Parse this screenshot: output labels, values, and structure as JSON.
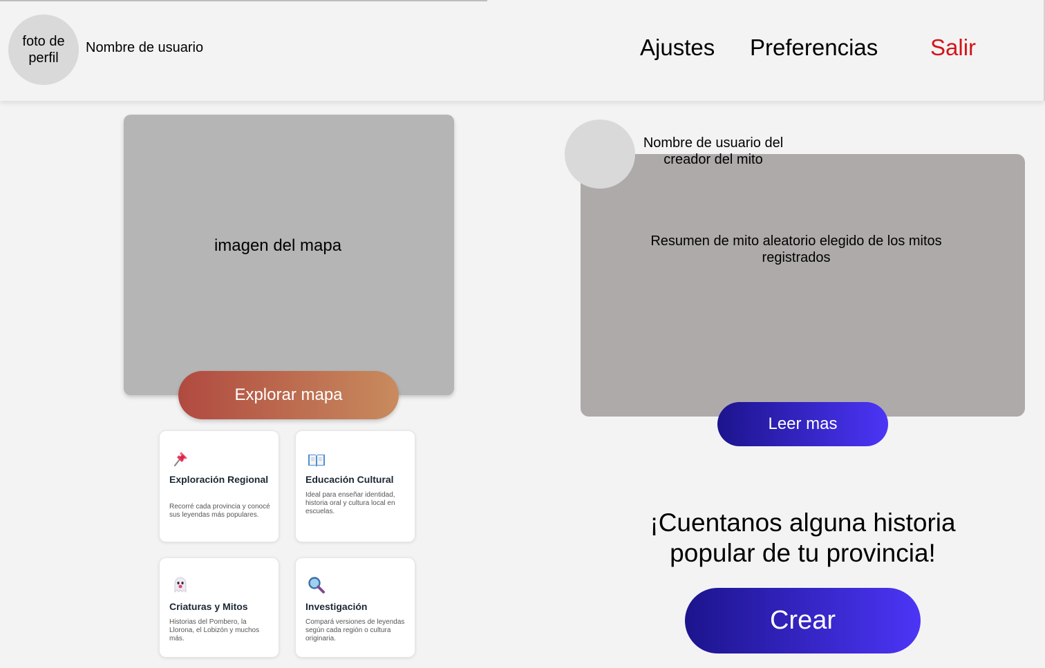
{
  "header": {
    "avatar_text": "foto de perfil",
    "username": "Nombre de usuario",
    "nav": {
      "settings": "Ajustes",
      "preferences": "Preferencias",
      "logout": "Salir"
    },
    "logout_color": "#d2151b"
  },
  "map": {
    "placeholder": "imagen del mapa",
    "button_label": "Explorar mapa"
  },
  "features": [
    {
      "icon": "pushpin-icon",
      "title": "Exploración Regional",
      "description": "Recorré cada provincia y conocé sus leyendas más populares."
    },
    {
      "icon": "open-book-icon",
      "title": "Educación Cultural",
      "description": "Ideal para enseñar identidad, historia oral y cultura local en escuelas."
    },
    {
      "icon": "ghost-icon",
      "title": "Criaturas y Mitos",
      "description": "Historias del Pombero, la Llorona, el Lobizón y muchos más."
    },
    {
      "icon": "magnifier-icon",
      "title": "Investigación",
      "description": "Compará versiones de leyendas según cada región o cultura originaria."
    }
  ],
  "myth": {
    "creator_name": "Nombre de usuario del creador del mito",
    "summary": "Resumen de mito aleatorio elegido de los mitos registrados",
    "read_more_label": "Leer mas"
  },
  "cta": {
    "text": "¡Cuentanos alguna historia popular de tu provincia!",
    "create_label": "Crear"
  },
  "colors": {
    "accent_gradient_start": "#1c148d",
    "accent_gradient_end": "#4c35f6",
    "explore_gradient_start": "#b04a40",
    "explore_gradient_end": "#c88b5e"
  }
}
